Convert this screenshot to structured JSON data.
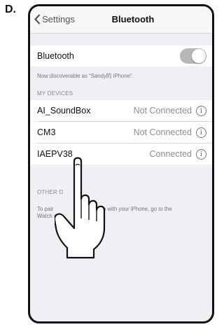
{
  "step_label": "D.",
  "navbar": {
    "back_label": "Settings",
    "title": "Bluetooth"
  },
  "bluetooth": {
    "label": "Bluetooth",
    "toggle_on": true
  },
  "discoverable_text": "Now discoverable as “Sandy的 iPhone”.",
  "my_devices": {
    "header": "MY DEVICES",
    "items": [
      {
        "name": "AI_SoundBox",
        "status": "Not Connected"
      },
      {
        "name": "CM3",
        "status": "Not Connected"
      },
      {
        "name": "IAEPV38",
        "status": "Connected"
      }
    ]
  },
  "other_devices": {
    "header": "OTHER D",
    "help_line1_left": "To pair",
    "help_line1_right": "ch with your iPhone, go to the",
    "help_line2_left": "Watch a"
  },
  "colors": {
    "page_bg": "#efeff4",
    "cell_bg": "#ffffff",
    "toggle_bg": "#b7b7b7"
  }
}
